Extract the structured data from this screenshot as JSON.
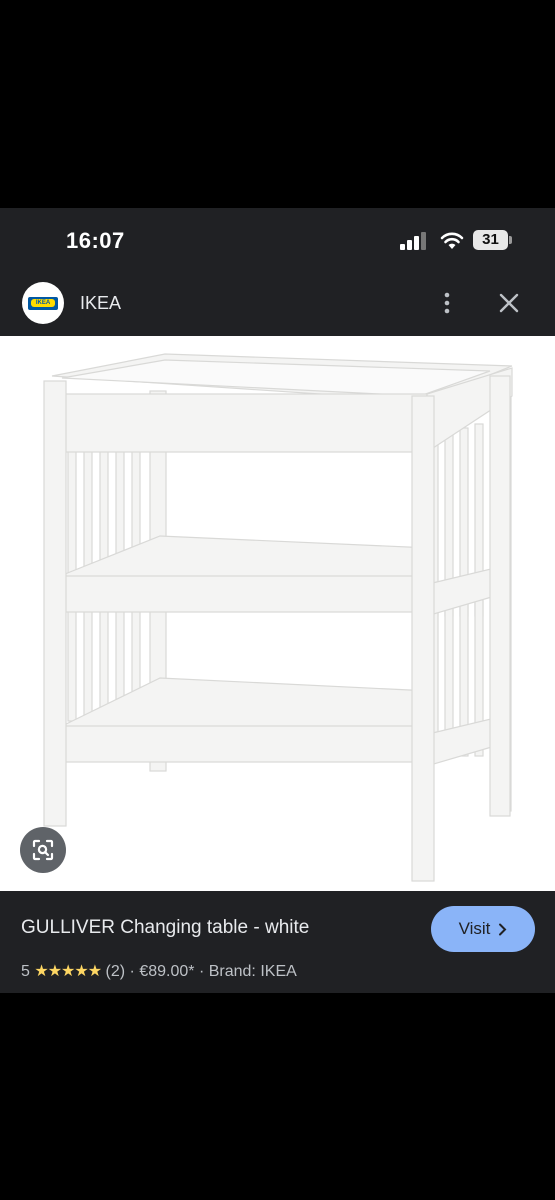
{
  "status_bar": {
    "time": "16:07",
    "battery": "31"
  },
  "site": {
    "name": "IKEA",
    "logo_text": "IKEA"
  },
  "product": {
    "title": "GULLIVER Changing table - white",
    "rating": "5",
    "stars": "★★★★★",
    "review_count": "(2)",
    "separator": "·",
    "price": "€89.00*",
    "brand": "Brand: IKEA"
  },
  "actions": {
    "visit_label": "Visit"
  },
  "colors": {
    "accent": "#8ab4f8",
    "panel": "#202124",
    "star": "#fdd663"
  }
}
